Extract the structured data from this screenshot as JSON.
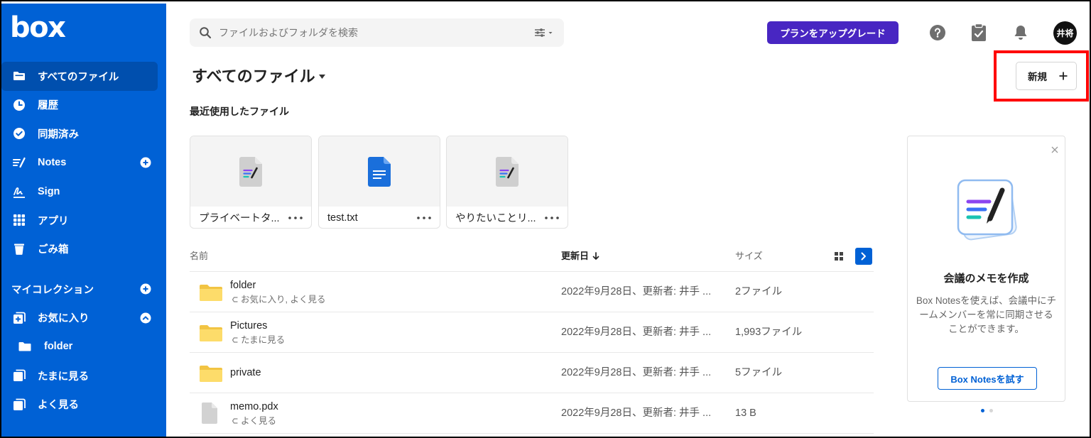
{
  "colors": {
    "sidebar": "#0061d5",
    "sidebar_active": "#004fae",
    "upgrade_button": "#4826c2",
    "accent": "#0061d5",
    "highlight": "#ff0000"
  },
  "app": {
    "logo": "box"
  },
  "sidebar": {
    "items": [
      {
        "label": "すべてのファイル",
        "icon": "folder-icon",
        "active": true
      },
      {
        "label": "履歴",
        "icon": "clock-icon"
      },
      {
        "label": "同期済み",
        "icon": "check-circle-icon"
      },
      {
        "label": "Notes",
        "icon": "notes-icon",
        "action_icon": "add-circle-icon"
      },
      {
        "label": "Sign",
        "icon": "signature-icon"
      },
      {
        "label": "アプリ",
        "icon": "apps-grid-icon"
      },
      {
        "label": "ごみ箱",
        "icon": "trash-icon"
      }
    ],
    "collections": {
      "heading": "マイコレクション",
      "heading_action_icon": "add-circle-icon",
      "favorites": {
        "label": "お気に入り",
        "icon": "collection-icon",
        "toggle_icon": "chevron-up-circle-icon",
        "expanded": true
      },
      "favorites_children": [
        {
          "label": "folder",
          "icon": "folder-icon"
        }
      ],
      "items": [
        {
          "label": "たまに見る",
          "icon": "collection-icon"
        },
        {
          "label": "よく見る",
          "icon": "collection-icon"
        }
      ]
    }
  },
  "header": {
    "search": {
      "placeholder": "ファイルおよびフォルダを検索",
      "value": "",
      "icon": "search-icon",
      "filter_icon": "filter-sliders-icon"
    },
    "upgrade_label": "プランをアップグレード",
    "icons": [
      "help-icon",
      "tasks-icon",
      "notifications-bell-icon"
    ],
    "avatar_initials": "井将"
  },
  "page": {
    "title": "すべてのファイル",
    "new_button_label": "新規",
    "new_button_icon": "plus-icon"
  },
  "recent": {
    "heading": "最近使用したファイル",
    "files": [
      {
        "name": "プライベートタ...",
        "type": "boxnote"
      },
      {
        "name": "test.txt",
        "type": "text"
      },
      {
        "name": "やりたいことリ...",
        "type": "boxnote"
      }
    ]
  },
  "table": {
    "columns": {
      "name": "名前",
      "updated": "更新日",
      "size": "サイズ"
    },
    "sort": {
      "column": "updated",
      "direction": "descending"
    },
    "rows": [
      {
        "name": "folder",
        "type": "folder",
        "tags": "お気に入り, よく見る",
        "updated": "2022年9月28日、更新者: 井手 ...",
        "size": "2ファイル"
      },
      {
        "name": "Pictures",
        "type": "folder",
        "tags": "たまに見る",
        "updated": "2022年9月28日、更新者: 井手 ...",
        "size": "1,993ファイル"
      },
      {
        "name": "private",
        "type": "folder",
        "updated": "2022年9月28日、更新者: 井手 ...",
        "size": "5ファイル"
      },
      {
        "name": "memo.pdx",
        "type": "file",
        "tags": "よく見る",
        "updated": "2022年9月28日、更新者: 井手 ...",
        "size": "13 B"
      }
    ]
  },
  "promo": {
    "title": "会議のメモを作成",
    "description": "Box Notesを使えば、会議中にチームメンバーを常に同期させることができます。",
    "button_label": "Box Notesを試す",
    "close_icon": "close-icon",
    "pages_total": 2,
    "page_current": 1
  }
}
